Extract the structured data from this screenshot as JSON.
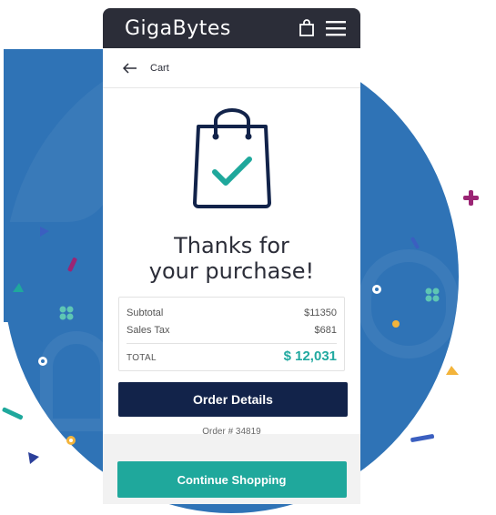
{
  "app": {
    "brand": "GigaBytes"
  },
  "header": {
    "title": "Cart"
  },
  "main": {
    "heading": "Thanks for your purchase!",
    "summary": {
      "subtotal_label": "Subtotal",
      "subtotal_value": "$11350",
      "tax_label": "Sales Tax",
      "tax_value": "$681",
      "total_label": "TOTAL",
      "total_value": "$ 12,031"
    },
    "order_details_label": "Order Details",
    "order_number": "Order # 34819",
    "continue_label": "Continue Shopping"
  },
  "icons": {
    "topbar": [
      "shopping-bag-icon",
      "menu-icon"
    ],
    "back": "arrow-left-icon",
    "hero": "shopping-bag-check-icon"
  },
  "colors": {
    "accent": "#1fa89c",
    "primary_dark": "#12234a",
    "topbar": "#2b2d38",
    "background_blue": "#2f73b6"
  }
}
